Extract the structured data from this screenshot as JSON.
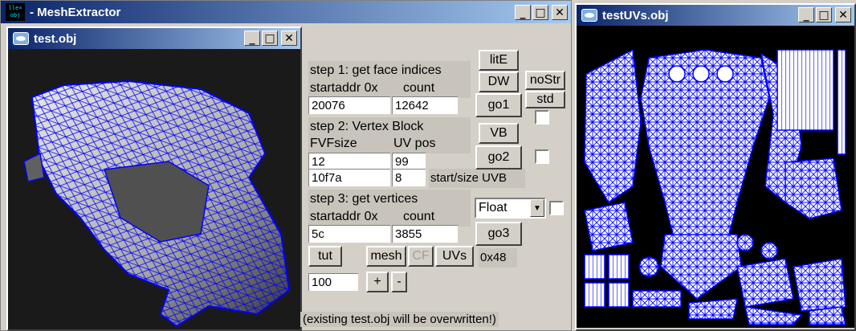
{
  "main_window": {
    "title": "- MeshExtractor",
    "logo": "lle×\nobj"
  },
  "child_window": {
    "title": "test.obj",
    "viewport_bg": "#1a1a1a",
    "mesh_color": "#0000ff"
  },
  "uv_window": {
    "title": "testUVs.obj",
    "uv_color": "#0000ff"
  },
  "window_controls": {
    "minimize": "_",
    "maximize": "□",
    "close": "✕"
  },
  "step1": {
    "label": "step 1: get face indices",
    "sublabel_a": "startaddr 0x",
    "sublabel_b": "count",
    "startaddr_value": "20076",
    "count_value": "12642"
  },
  "step2": {
    "label": "step 2: Vertex Block",
    "sublabel_a": "FVFsize",
    "sublabel_b": "UV pos",
    "fvfsize_value": "12",
    "uvpos_value": "99",
    "field3_value": "10f7a",
    "field4_value": "8",
    "startsize_uvb_label": "start/size UVB"
  },
  "step3": {
    "label": "step 3: get vertices",
    "sublabel_a": "startaddr 0x",
    "sublabel_b": "count",
    "startaddr_value": "5c",
    "count_value": "3855",
    "format_select": "Float"
  },
  "buttons": {
    "lite": "litE",
    "dw": "DW",
    "nostr": "noStr",
    "std": "std",
    "go1": "go1",
    "vb": "VB",
    "go2": "go2",
    "go3": "go3",
    "tut": "tut",
    "mesh": "mesh",
    "cf": "CF",
    "uvs": "UVs",
    "plus": "+",
    "minus": "-"
  },
  "hex_label": "0x48",
  "scale_value": "100",
  "footer_note": "(existing test.obj will be overwritten!)"
}
